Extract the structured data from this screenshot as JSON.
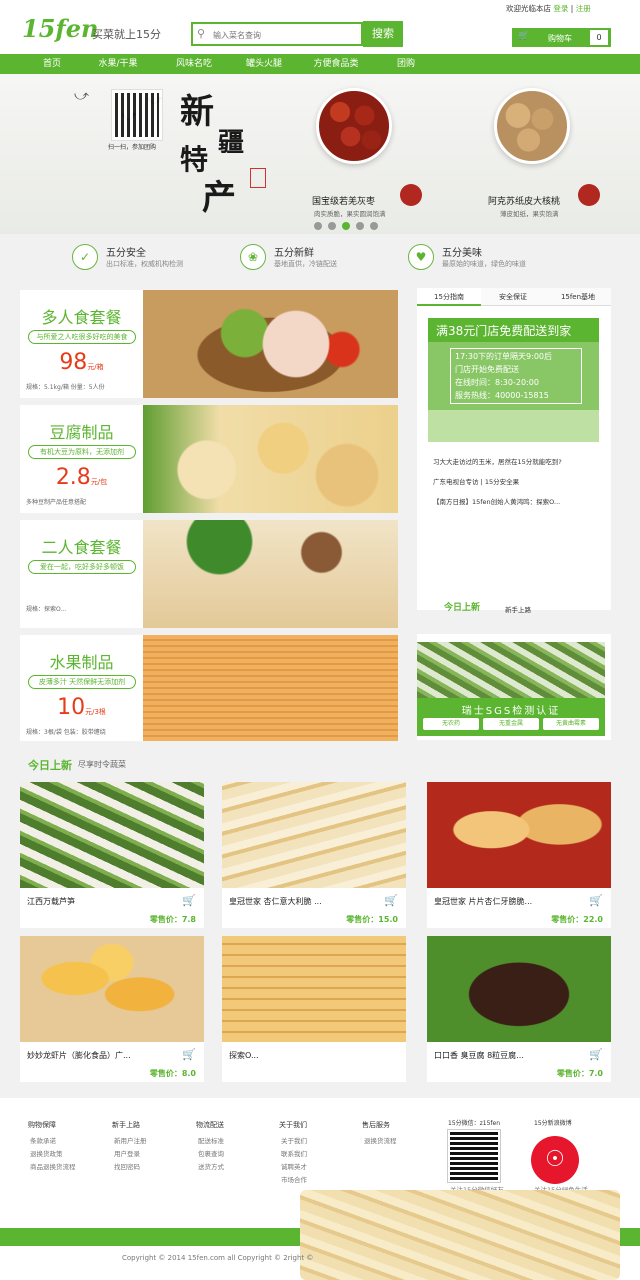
{
  "header": {
    "logo": "15fen",
    "slogan": "买菜就上15分",
    "search_placeholder": "输入菜名查询",
    "search_button": "搜索",
    "welcome": "欢迎光临本店",
    "login": "登录",
    "register": "注册",
    "cart_label": "购物车",
    "cart_count": "0"
  },
  "nav": [
    "首页",
    "水果/干果",
    "风味名吃",
    "罐头火腿",
    "方便食品类",
    "团购"
  ],
  "banner": {
    "calligraphy": [
      "新",
      "疆",
      "特",
      "产"
    ],
    "qr_caption": "扫一扫，参加团购",
    "products": [
      {
        "title": "国宝级若羌灰枣",
        "sub": "肉实质脆，果实圆润饱满"
      },
      {
        "title": "阿克苏纸皮大核桃",
        "sub": "薄皮如纸，果实饱满"
      }
    ]
  },
  "guarantees": [
    {
      "icon": "shield-icon",
      "title": "五分安全",
      "sub": "出口标准，权威机构检测"
    },
    {
      "icon": "leaf-icon",
      "title": "五分新鲜",
      "sub": "基地直供，冷链配送"
    },
    {
      "icon": "taste-icon",
      "title": "五分美味",
      "sub": "最原始的味道，绿色的味道"
    }
  ],
  "categories": [
    {
      "title": "多人食套餐",
      "tag": "与所爱之人吃很多好吃的美食",
      "price": "98",
      "unit": "元/箱",
      "info": "规格：5.1kg/箱  份量：5人份"
    },
    {
      "title": "豆腐制品",
      "tag": "有机大豆为原料，无添加剂",
      "price": "2.8",
      "unit": "元/包",
      "info": "多种豆制产品任意搭配"
    },
    {
      "title": "二人食套餐",
      "tag": "爱在一起，吃好多好多顿饭",
      "price": "",
      "unit": "",
      "info": "规格：探索O..."
    },
    {
      "title": "水果制品",
      "tag": "皮薄多汁  天然保鲜无添加剂",
      "price": "10",
      "unit": "元/3根",
      "info": "规格：3根/袋  包装：胶带缠绕"
    }
  ],
  "side": {
    "tabs": [
      "15分指南",
      "安全保证",
      "15fen基地"
    ],
    "ad_head": "满38元门店免费配送到家",
    "ad_lines": [
      "17:30下的订单隔天9:00后",
      "门店开始免费配送",
      "在线时间：8:30-20:00",
      "服务热线：40000-15815"
    ],
    "news": [
      "习大大走访过的玉米，居然在15分就能吃到?",
      "广东电视台专访 | 15分安全果",
      "【南方日报】15fen创始人黄鸿鸣：探索O..."
    ],
    "today_tag": "今日上新",
    "newbie_tag": "新手上路",
    "sgs_title": "瑞士SGS检测认证",
    "sgs_pills": [
      "无农药",
      "无重金属",
      "无黄曲霉素"
    ]
  },
  "new_section": {
    "title": "今日上新",
    "sub": "尽享时令蔬菜"
  },
  "products": [
    {
      "name": "江西万载芦笋",
      "price_label": "零售价：",
      "price": "7.8"
    },
    {
      "name": "皇冠世家 杏仁意大利脆 ...",
      "price_label": "零售价：",
      "price": "15.0"
    },
    {
      "name": "皇冠世家 片片杏仁牙膀脆...",
      "price_label": "零售价：",
      "price": "22.0"
    },
    {
      "name": "妙妙龙虾片（膨化食品）广...",
      "price_label": "零售价：",
      "price": "8.0"
    },
    {
      "name": "探索O...",
      "price_label": "",
      "price": ""
    },
    {
      "name": "口口香 臭豆腐 8粒豆腐...",
      "price_label": "零售价：",
      "price": "7.0"
    }
  ],
  "footer": {
    "columns": [
      {
        "title": "购物保障",
        "links": [
          "条款承诺",
          "退换货政策",
          "商品退换货流程"
        ]
      },
      {
        "title": "新手上路",
        "links": [
          "新用户注册",
          "用户登录",
          "找回密码"
        ]
      },
      {
        "title": "物流配送",
        "links": [
          "配送标准",
          "包裹查询",
          "送货方式"
        ]
      },
      {
        "title": "关于我们",
        "links": [
          "关于我们",
          "联系我们",
          "诚聘英才",
          "市场合作"
        ]
      },
      {
        "title": "售后服务",
        "links": [
          "退换货流程"
        ]
      }
    ],
    "weixin_title": "15分微信：z15fen",
    "weixin_caption": "关注15分微信好友",
    "weibo_title": "15分新浪微博",
    "weibo_caption": "关注15分绿色生活",
    "copyright": "Copyright © 2014 15fen.com all Copyright © 2right ©"
  },
  "colors": {
    "brand": "#5cb531",
    "price": "#e63c1a"
  }
}
